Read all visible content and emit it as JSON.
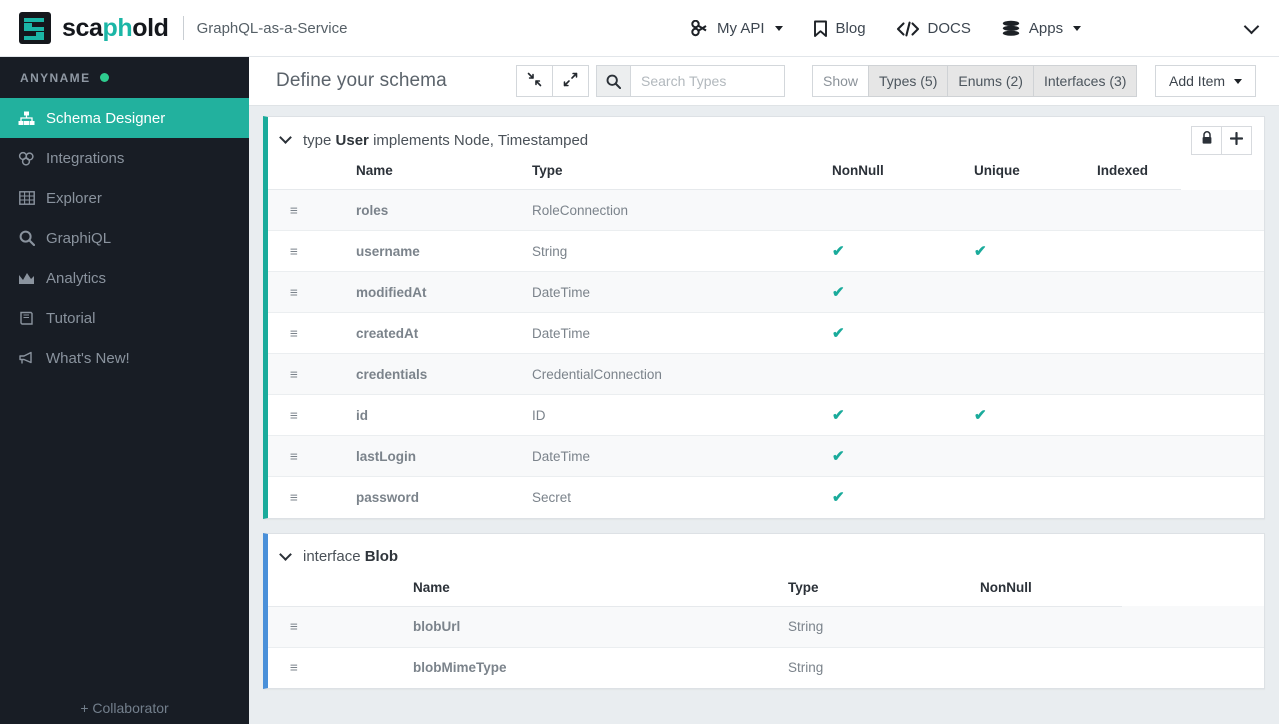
{
  "topbar": {
    "brand_prefix": "sca",
    "brand_accent": "ph",
    "brand_suffix": "old",
    "tagline": "GraphQL-as-a-Service",
    "nav": [
      {
        "label": "My API",
        "icon": "link-icon",
        "caret": true
      },
      {
        "label": "Blog",
        "icon": "bookmark-icon",
        "caret": false
      },
      {
        "label": "DOCS",
        "icon": "code-icon",
        "caret": false
      },
      {
        "label": "Apps",
        "icon": "database-icon",
        "caret": true
      }
    ],
    "right_caret_icon": "chevron-down-icon"
  },
  "sidebar": {
    "account": "ANYNAME",
    "status_color": "#2ecc8f",
    "items": [
      {
        "label": "Schema Designer",
        "icon": "sitemap-icon",
        "active": true
      },
      {
        "label": "Integrations",
        "icon": "puzzle-icon",
        "active": false
      },
      {
        "label": "Explorer",
        "icon": "table-icon",
        "active": false
      },
      {
        "label": "GraphiQL",
        "icon": "search-icon",
        "active": false
      },
      {
        "label": "Analytics",
        "icon": "chart-icon",
        "active": false
      },
      {
        "label": "Tutorial",
        "icon": "book-icon",
        "active": false
      },
      {
        "label": "What's New!",
        "icon": "megaphone-icon",
        "active": false
      }
    ],
    "collaborator": "+ Collaborator"
  },
  "toolbar": {
    "title": "Define your schema",
    "collapse_icon": "collapse-arrows-icon",
    "expand_icon": "expand-arrows-icon",
    "search_icon": "search-icon",
    "search_value": "",
    "search_placeholder": "Search Types",
    "show_label": "Show",
    "filters": [
      {
        "label": "Types (5)",
        "active": true
      },
      {
        "label": "Enums (2)",
        "active": true
      },
      {
        "label": "Interfaces (3)",
        "active": true
      }
    ],
    "add_item_label": "Add Item"
  },
  "cards": [
    {
      "kind": "type",
      "kind_label": "type",
      "name": "User",
      "implements_label": "implements Node, Timestamped",
      "accent": "#1aab9b",
      "lock_icon": "lock-icon",
      "add_icon": "plus-icon",
      "columns": [
        "Name",
        "Type",
        "NonNull",
        "Unique",
        "Indexed"
      ],
      "rows": [
        {
          "name": "roles",
          "type": "RoleConnection",
          "nonnull": false,
          "unique": false,
          "indexed": false
        },
        {
          "name": "username",
          "type": "String",
          "nonnull": true,
          "unique": true,
          "indexed": false
        },
        {
          "name": "modifiedAt",
          "type": "DateTime",
          "nonnull": true,
          "unique": false,
          "indexed": false
        },
        {
          "name": "createdAt",
          "type": "DateTime",
          "nonnull": true,
          "unique": false,
          "indexed": false
        },
        {
          "name": "credentials",
          "type": "CredentialConnection",
          "nonnull": false,
          "unique": false,
          "indexed": false
        },
        {
          "name": "id",
          "type": "ID",
          "nonnull": true,
          "unique": true,
          "indexed": false
        },
        {
          "name": "lastLogin",
          "type": "DateTime",
          "nonnull": true,
          "unique": false,
          "indexed": false
        },
        {
          "name": "password",
          "type": "Secret",
          "nonnull": true,
          "unique": false,
          "indexed": false
        }
      ]
    },
    {
      "kind": "interface",
      "kind_label": "interface",
      "name": "Blob",
      "implements_label": "",
      "accent": "#4a90d9",
      "columns": [
        "Name",
        "Type",
        "NonNull"
      ],
      "rows": [
        {
          "name": "blobUrl",
          "type": "String",
          "nonnull": false
        },
        {
          "name": "blobMimeType",
          "type": "String",
          "nonnull": false
        }
      ]
    }
  ],
  "icons": {
    "check": "✔",
    "handle": "≡"
  }
}
